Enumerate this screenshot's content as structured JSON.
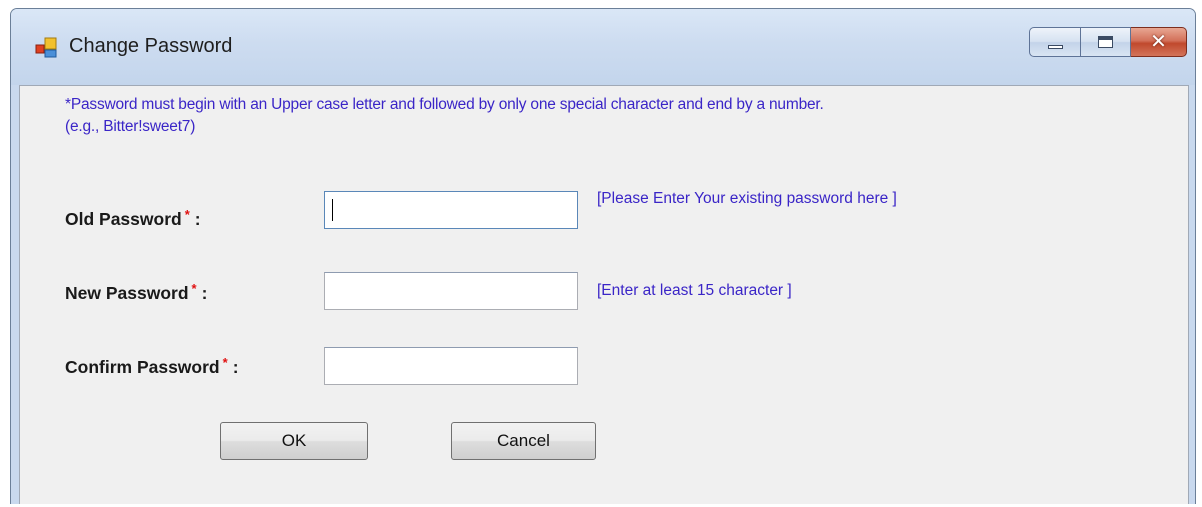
{
  "window": {
    "title": "Change Password",
    "icon": "app-form-icon",
    "caption_buttons": [
      "minimize",
      "maximize",
      "close"
    ]
  },
  "hint": {
    "line1": "*Password must begin with an Upper case letter and followed by only one special character and end by a number.",
    "line2": "(e.g., Bitter!sweet7)"
  },
  "fields": [
    {
      "label": "Old Password",
      "required_marker": "*",
      "colon": ":",
      "value": "",
      "note": "[Please Enter Your existing password here ]"
    },
    {
      "label": "New Password",
      "required_marker": "*",
      "colon": ":",
      "value": "",
      "note": "[Enter at least 15 character ]"
    },
    {
      "label": "Confirm Password",
      "required_marker": "*",
      "colon": ":",
      "value": "",
      "note": ""
    }
  ],
  "buttons": {
    "ok": "OK",
    "cancel": "Cancel"
  },
  "colors": {
    "hint_text": "#3a25c7",
    "required_marker": "#e01010",
    "client_background": "#f0f0f0"
  }
}
